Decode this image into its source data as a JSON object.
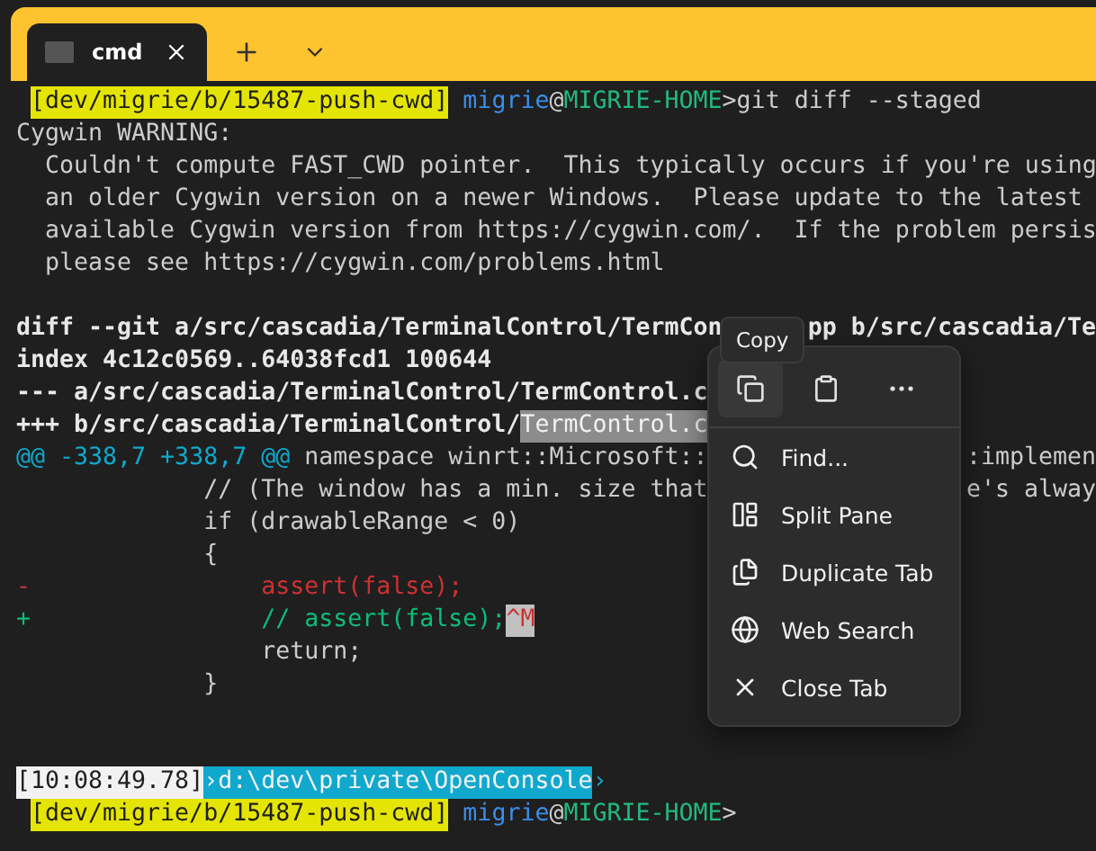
{
  "tab": {
    "title": "cmd",
    "selected": true
  },
  "terminal": {
    "lines": [
      {
        "kind": "prompt",
        "segments": [
          {
            "kind": "path",
            "text": "[dev/migrie/b/15487-push-cwd]"
          },
          {
            "kind": "user",
            "text": " migrie"
          },
          {
            "kind": "at",
            "text": "@"
          },
          {
            "kind": "host",
            "text": "MIGRIE-HOME"
          },
          {
            "kind": "plain",
            "text": ">git diff --staged"
          }
        ]
      },
      {
        "kind": "text",
        "segments": [
          {
            "kind": "plain",
            "text": "Cygwin WARNING:"
          }
        ]
      },
      {
        "kind": "text",
        "segments": [
          {
            "kind": "plain",
            "text": "  Couldn't compute FAST_CWD pointer.  This typically occurs if you're using"
          }
        ]
      },
      {
        "kind": "text",
        "segments": [
          {
            "kind": "plain",
            "text": "  an older Cygwin version on a newer Windows.  Please update to the latest"
          }
        ]
      },
      {
        "kind": "text",
        "segments": [
          {
            "kind": "plain",
            "text": "  available Cygwin version from https://cygwin.com/.  If the problem persis"
          }
        ]
      },
      {
        "kind": "text",
        "segments": [
          {
            "kind": "plain",
            "text": "  please see https://cygwin.com/problems.html"
          }
        ]
      },
      {
        "kind": "blank"
      },
      {
        "kind": "text",
        "segments": [
          {
            "kind": "bold",
            "text": "diff --git a/src/cascadia/TerminalControl/TermCon"
          }
        ],
        "right": [
          {
            "kind": "bold",
            "text": "pp b/src/cascadia/Te"
          }
        ]
      },
      {
        "kind": "text",
        "segments": [
          {
            "kind": "bold",
            "text": "index 4c12c0569..64038fcd1 100644"
          }
        ]
      },
      {
        "kind": "text",
        "segments": [
          {
            "kind": "bold",
            "text": "--- a/src/cascadia/TerminalControl/TermControl.c"
          }
        ]
      },
      {
        "kind": "text",
        "segments": [
          {
            "kind": "bold",
            "text": "+++ b/src/cascadia/TerminalControl/"
          },
          {
            "kind": "selection",
            "text": "TermControl.c"
          }
        ]
      },
      {
        "kind": "text",
        "segments": [
          {
            "kind": "cyan",
            "text": "@@ -338,7 +338,7 @@"
          },
          {
            "kind": "plain",
            "text": " namespace winrt::Microsoft::"
          }
        ],
        "right": [
          {
            "kind": "plain",
            "text": ":implemen"
          }
        ]
      },
      {
        "kind": "text",
        "segments": [
          {
            "kind": "plain",
            "text": "             // (The window has a min. size that"
          }
        ],
        "right": [
          {
            "kind": "plain",
            "text": "e's alway"
          }
        ]
      },
      {
        "kind": "text",
        "segments": [
          {
            "kind": "plain",
            "text": "             if (drawableRange < 0)"
          }
        ]
      },
      {
        "kind": "text",
        "segments": [
          {
            "kind": "plain",
            "text": "             {"
          }
        ]
      },
      {
        "kind": "text",
        "segments": [
          {
            "kind": "red",
            "text": "-                assert(false);"
          }
        ]
      },
      {
        "kind": "text",
        "segments": [
          {
            "kind": "green",
            "text": "+                // assert(false);"
          },
          {
            "kind": "cr",
            "text": "^M"
          }
        ]
      },
      {
        "kind": "text",
        "segments": [
          {
            "kind": "plain",
            "text": "                 return;"
          }
        ]
      },
      {
        "kind": "text",
        "segments": [
          {
            "kind": "plain",
            "text": "             }"
          }
        ]
      },
      {
        "kind": "blank"
      },
      {
        "kind": "blank"
      },
      {
        "kind": "text",
        "segments": [
          {
            "kind": "time",
            "text": "[10:08:49.78]"
          },
          {
            "kind": "dir",
            "text": "›d:\\dev\\private\\OpenConsole"
          },
          {
            "kind": "arrow",
            "text": "›"
          }
        ]
      },
      {
        "kind": "prompt",
        "segments": [
          {
            "kind": "path",
            "text": "[dev/migrie/b/15487-push-cwd]"
          },
          {
            "kind": "user",
            "text": " migrie"
          },
          {
            "kind": "at",
            "text": "@"
          },
          {
            "kind": "host",
            "text": "MIGRIE-HOME"
          },
          {
            "kind": "plain",
            "text": ">"
          }
        ]
      }
    ]
  },
  "context_menu": {
    "tooltip": "Copy",
    "actions": [
      {
        "kind": "copy",
        "hovered": true
      },
      {
        "kind": "paste",
        "hovered": false
      },
      {
        "kind": "more",
        "hovered": false
      }
    ],
    "items": [
      {
        "kind": "find",
        "label": "Find..."
      },
      {
        "kind": "split",
        "label": "Split Pane"
      },
      {
        "kind": "duplicate",
        "label": "Duplicate Tab"
      },
      {
        "kind": "web",
        "label": "Web Search"
      },
      {
        "kind": "close",
        "label": "Close Tab"
      }
    ]
  }
}
